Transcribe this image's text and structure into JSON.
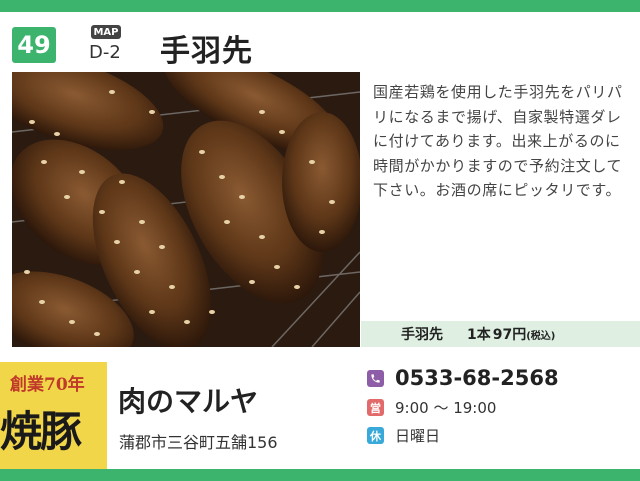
{
  "entry": {
    "number": "49",
    "map_label": "MAP",
    "map_code": "D-2",
    "title": "手羽先"
  },
  "description": "国産若鶏を使用した手羽先をパリパリになるまで揚げ、自家製特選ダレに付けてあります。出来上がるのに時間がかかりますので予約注文して下さい。お酒の席にピッタリです。",
  "price": {
    "item": "手羽先",
    "quantity": "1本",
    "value": "97円",
    "note": "(税込)"
  },
  "shop": {
    "sign_top": "創業70年",
    "sign_main": "焼豚",
    "name": "肉のマルヤ",
    "address": "蒲郡市三谷町五舗156",
    "phone": "0533-68-2568",
    "open_icon": "営",
    "hours": "9:00 〜 19:00",
    "closed_icon": "休",
    "closed_day": "日曜日"
  },
  "colors": {
    "accent_green": "#3cb46e",
    "price_bar_bg": "#dff0e2",
    "phone_icon": "#8e5da8",
    "open_icon": "#e36a6a",
    "closed_icon": "#38a9d8"
  }
}
